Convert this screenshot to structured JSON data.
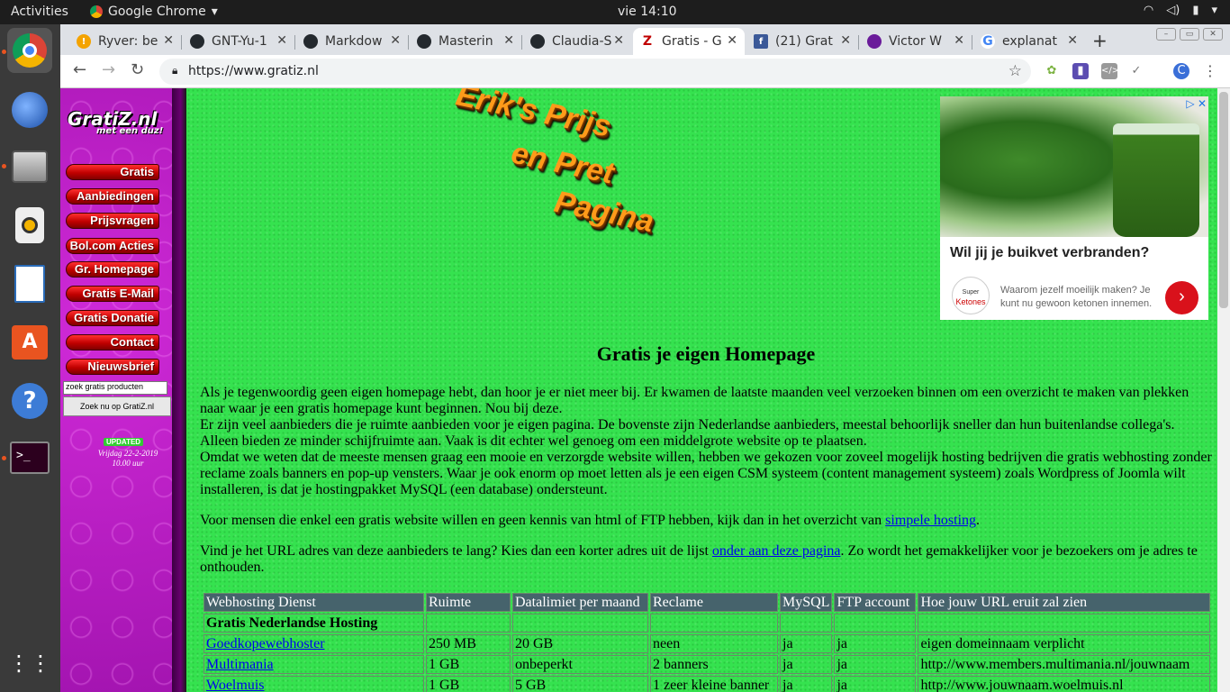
{
  "desktop": {
    "activities": "Activities",
    "app_name": "Google Chrome",
    "clock": "vie 14:10"
  },
  "browser": {
    "tabs": [
      {
        "title": "Ryver: be",
        "favicon": "ryver-icon",
        "color": "#f4a300"
      },
      {
        "title": "GNT-Yu-1",
        "favicon": "github-icon",
        "color": "#24292e"
      },
      {
        "title": "Markdow",
        "favicon": "github-icon",
        "color": "#24292e"
      },
      {
        "title": "Masterin",
        "favicon": "github-icon",
        "color": "#24292e"
      },
      {
        "title": "Claudia-S",
        "favicon": "github-icon",
        "color": "#24292e"
      },
      {
        "title": "Gratis - G",
        "favicon": "gratiz-icon",
        "color": "#c00000",
        "active": true
      },
      {
        "title": "(21) Grat",
        "favicon": "facebook-icon",
        "color": "#3b5998"
      },
      {
        "title": "Victor W",
        "favicon": "victor-icon",
        "color": "#6a1b9a"
      },
      {
        "title": "explanat",
        "favicon": "google-icon",
        "color": "#4285f4"
      }
    ],
    "url": "https://www.gratiz.nl",
    "profile_initial": "C"
  },
  "sidebar": {
    "logo_main": "GratiZ.nl",
    "logo_sub": "met een duz!",
    "menu": [
      "Gratis",
      "Aanbiedingen",
      "Prijsvragen",
      "Bol.com Acties",
      "Gr. Homepage",
      "Gratis E-Mail",
      "Gratis Donatie",
      "Contact",
      "Nieuwsbrief"
    ],
    "search_placeholder": "zoek gratis producten",
    "search_button": "Zoek nu op GratiZ.nl",
    "updated_badge": "UPDATED",
    "updated_date": "Vrijdag 22-2-2019",
    "updated_time": "10.00 uur"
  },
  "banner": {
    "line1": "Erik's Prijs",
    "line2": "en Pret",
    "line3": "Pagina"
  },
  "ad": {
    "headline": "Wil jij je buikvet verbranden?",
    "brand_top": "Super",
    "brand": "Ketones",
    "description": "Waarom jezelf moeilijk maken? Je kunt nu gewoon ketonen innemen."
  },
  "content": {
    "heading": "Gratis je eigen Homepage",
    "p1_l1": "Als je tegenwoordig geen eigen homepage hebt, dan hoor je er niet meer bij. Er kwamen de laatste maanden veel verzoeken binnen om een overzicht te maken van plekken",
    "p1_l2": "naar waar je een gratis homepage kunt beginnen. Nou bij deze.",
    "p1_l3": "Er zijn veel aanbieders die je ruimte aanbieden voor je eigen pagina. De bovenste zijn Nederlandse aanbieders, meestal behoorlijk sneller dan hun buitenlandse collega's.",
    "p1_l4": "Alleen bieden ze minder schijfruimte aan. Vaak is dit echter wel genoeg om een middelgrote website op te plaatsen.",
    "p1_l5": "Omdat we weten dat de meeste mensen graag een mooie en verzorgde website willen, hebben we gekozen voor zoveel mogelijk hosting bedrijven die gratis webhosting zonder",
    "p1_l6": "reclame zoals banners en pop-up vensters. Waar je ook enorm op moet letten als je een eigen CSM systeem (content management systeem) zoals Wordpress of Joomla wilt",
    "p1_l7": "installeren, is dat je hostingpakket MySQL (een database) ondersteunt.",
    "p2_text": "Voor mensen die enkel een gratis website willen en geen kennis van html of FTP hebben, kijk dan in het overzicht van ",
    "p2_link": "simpele hosting",
    "p2_end": ".",
    "p3_text": "Vind je het URL adres van deze aanbieders te lang? Kies dan een korter adres uit de lijst ",
    "p3_link": "onder aan deze pagina",
    "p3_end": ". Zo wordt het gemakkelijker voor je bezoekers om je adres te",
    "p3_l2": "onthouden."
  },
  "table": {
    "headers": [
      "Webhosting Dienst",
      "Ruimte",
      "Datalimiet per maand",
      "Reclame",
      "MySQL",
      "FTP account",
      "Hoe jouw URL eruit zal zien"
    ],
    "section": "Gratis Nederlandse Hosting",
    "rows": [
      [
        "Goedkopewebhoster",
        "250 MB",
        "20 GB",
        "neen",
        "ja",
        "ja",
        "eigen domeinnaam verplicht"
      ],
      [
        "Multimania",
        "1 GB",
        "onbeperkt",
        "2 banners",
        "ja",
        "ja",
        "http://www.members.multimania.nl/jouwnaam"
      ],
      [
        "Woelmuis",
        "1 GB",
        "5 GB",
        "1 zeer kleine banner",
        "ja",
        "ja",
        "http://www.jouwnaam.woelmuis.nl"
      ]
    ]
  }
}
